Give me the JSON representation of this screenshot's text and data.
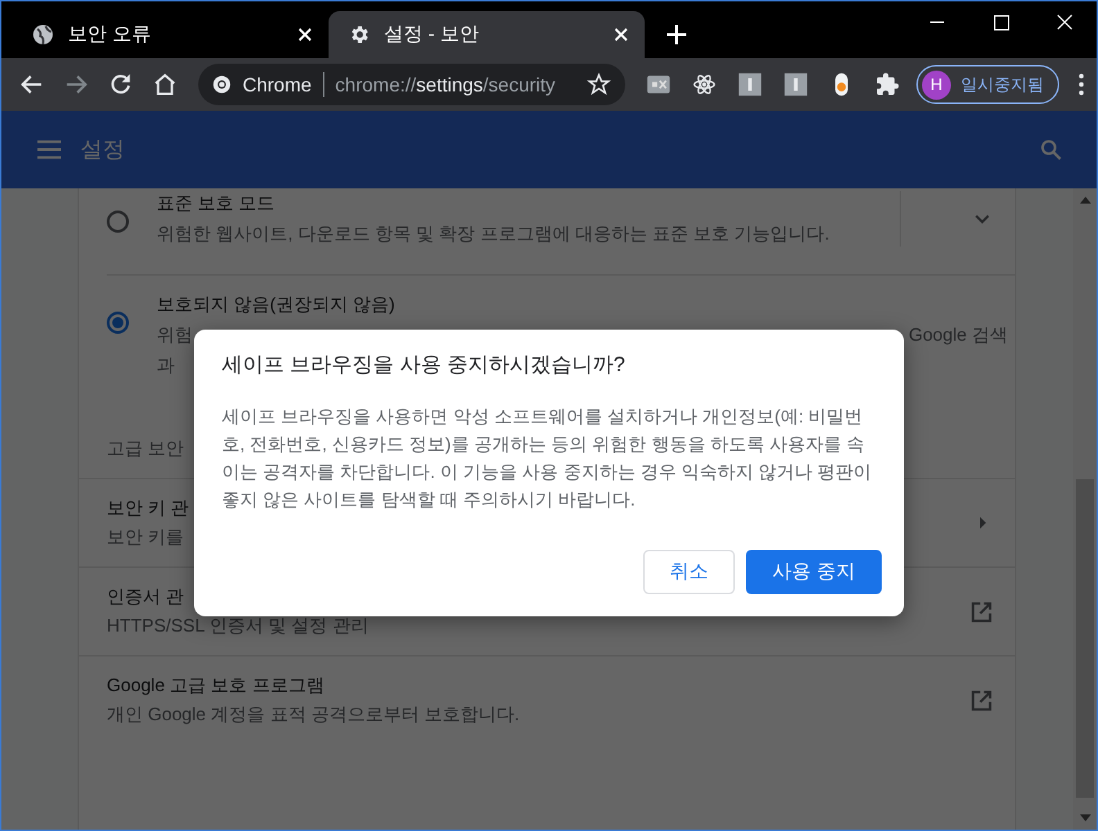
{
  "tabs": [
    {
      "title": "보안 오류",
      "selected": false
    },
    {
      "title": "설정 - 보안",
      "selected": true
    }
  ],
  "toolbar": {
    "site_chip": "Chrome",
    "url": "chrome://**settings**/security",
    "bookmarked": false,
    "extensions": [
      {
        "kind": "ex"
      },
      {
        "kind": "atom"
      },
      {
        "kind": "box"
      },
      {
        "kind": "box"
      },
      {
        "kind": "capsule"
      },
      {
        "kind": "puzzle"
      }
    ],
    "profile": {
      "initial": "H",
      "label": "일시중지됨"
    }
  },
  "header": {
    "title": "설정"
  },
  "settings": {
    "options": [
      {
        "title": "표준 보호 모드",
        "description": "위험한 웹사이트, 다운로드 항목 및 확장 프로그램에 대응하는 표준 보호 기능입니다.",
        "selected": false,
        "expanded": false
      },
      {
        "title": "보호되지 않음(권장되지 않음)",
        "description_start": "위험",
        "description_end": "Google 검색",
        "description_more": "과",
        "selected": true
      }
    ],
    "section_label": "고급 보안",
    "rows": [
      {
        "kind": "submenu",
        "title": "보안 키 관",
        "description": "보안 키를"
      },
      {
        "kind": "external",
        "title": "인증서 관",
        "description": "HTTPS/SSL 인증서 및 설정 관리"
      },
      {
        "kind": "external",
        "title": "Google 고급 보호 프로그램",
        "description": "개인 Google 계정을 표적 공격으로부터 보호합니다."
      }
    ]
  },
  "dialog": {
    "title": "세이프 브라우징을 사용 중지하시겠습니까?",
    "body": "세이프 브라우징을 사용하면 악성 소프트웨어를 설치하거나 개인정보(예: 비밀번호, 전화번호, 신용카드 정보)를 공개하는 등의 위험한 행동을 하도록 사용자를 속이는 공격자를 차단합니다. 이 기능을 사용 중지하는 경우 익숙하지 않거나 평판이 좋지 않은 사이트를 탐색할 때 주의하시기 바랍니다.",
    "buttons": [
      {
        "label": "취소",
        "kind": "secondary"
      },
      {
        "label": "사용 중지",
        "kind": "primary"
      }
    ]
  }
}
